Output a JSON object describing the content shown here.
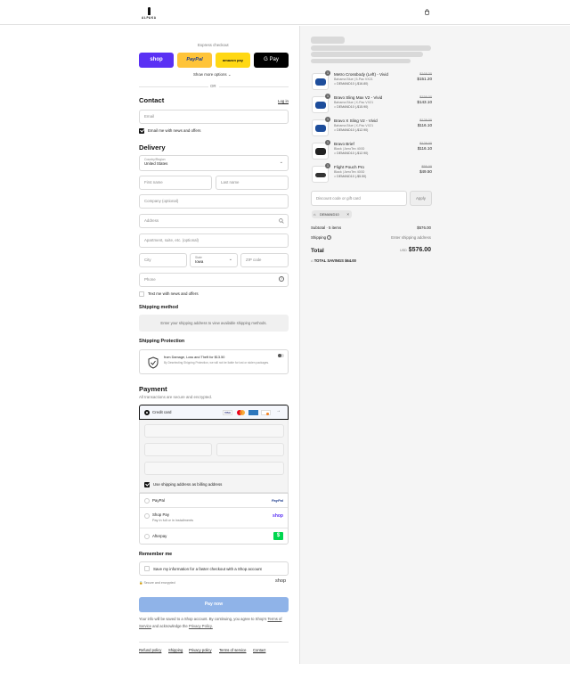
{
  "brand": {
    "name": "ALPAKA"
  },
  "express": {
    "title": "Express checkout",
    "buttons": [
      {
        "label": "shop",
        "color": "#5a31f4"
      },
      {
        "label": "PayPal",
        "color": "#ffc439"
      },
      {
        "label": "amazon pay",
        "color": "#ffd814"
      },
      {
        "label": "G Pay",
        "color": "#000000"
      }
    ],
    "show_more": "Show more options",
    "or": "OR"
  },
  "contact": {
    "heading": "Contact",
    "login": "Log in",
    "email_placeholder": "Email",
    "news_label": "Email me with news and offers"
  },
  "delivery": {
    "heading": "Delivery",
    "country_label": "Country/Region",
    "country_value": "United States",
    "first_name": "First name",
    "last_name": "Last name",
    "company": "Company (optional)",
    "address": "Address",
    "apartment": "Apartment, suite, etc. (optional)",
    "city": "City",
    "state_label": "State",
    "state_value": "Iowa",
    "zip": "ZIP code",
    "phone": "Phone",
    "text_label": "Text me with news and offers"
  },
  "shipping": {
    "heading": "Shipping method",
    "placeholder": "Enter your shipping address to view available shipping methods."
  },
  "protection": {
    "heading": "Shipping Protection",
    "title": "from Damage, Loss and Theft for $13.50",
    "desc": "By Deselecting Shipping Protection, we will not be liable for lost or stolen packages."
  },
  "payment": {
    "heading": "Payment",
    "subtitle": "All transactions are secure and encrypted.",
    "credit_card": "Credit card",
    "billing_label": "Use shipping address as billing address",
    "options": [
      {
        "label": "PayPal",
        "brand": "PayPal"
      },
      {
        "label": "Shop Pay",
        "sub": "Pay in full or in installments",
        "brand": "shop"
      },
      {
        "label": "Afterpay",
        "brand": "$"
      }
    ]
  },
  "remember": {
    "heading": "Remember me",
    "label": "Save my information for a faster checkout with a Shop account",
    "secure": "Secure and encrypted",
    "brand": "shop"
  },
  "pay_now": "Pay now",
  "legal": {
    "text1": "Your info will be saved to a Shop account. By continuing, you agree to Shop's",
    "tos": "Terms of Service",
    "text2": "and acknowledge the",
    "privacy": "Privacy Policy."
  },
  "footer": [
    "Refund policy",
    "Shipping",
    "Privacy policy",
    "Terms of service",
    "Contact"
  ],
  "cart": {
    "items": [
      {
        "qty": "1",
        "name": "Metro Crossbody (Left) - Vivid",
        "variant": "Bahama Blue | 5-Pac VX21",
        "discount": "DEMAND10 (-$16.80)",
        "old": "$168.00",
        "new": "$151.20",
        "color": "#1d4d9b"
      },
      {
        "qty": "1",
        "name": "Bravo Sling Max V2 - Vivid",
        "variant": "Bahama Blue | X-Pac VX21",
        "discount": "DEMAND10 (-$15.90)",
        "old": "$159.00",
        "new": "$143.10",
        "color": "#1d4d9b"
      },
      {
        "qty": "1",
        "name": "Bravo X Sling V2 - Vivid",
        "variant": "Bahama Blue | X-Pac VX21",
        "discount": "DEMAND10 (-$12.90)",
        "old": "$129.00",
        "new": "$116.10",
        "color": "#1d4d9b"
      },
      {
        "qty": "1",
        "name": "Bravo Brief",
        "variant": "Black | AeroTex 400D",
        "discount": "DEMAND10 (-$12.90)",
        "old": "$129.00",
        "new": "$116.10",
        "color": "#222222"
      },
      {
        "qty": "1",
        "name": "Flight Pouch Pro",
        "variant": "Black | AeroTex 400D",
        "discount": "DEMAND10 (-$5.50)",
        "old": "$55.00",
        "new": "$49.50",
        "color": "#333333"
      }
    ],
    "discount_placeholder": "Discount code or gift card",
    "apply": "Apply",
    "chip": "DEMAND10",
    "subtotal_label": "Subtotal · 5 items",
    "subtotal_value": "$576.00",
    "shipping_label": "Shipping",
    "shipping_value": "Enter shipping address",
    "total_label": "Total",
    "currency": "USD",
    "total_value": "$576.00",
    "savings_label": "TOTAL SAVINGS",
    "savings_value": "$64.00"
  }
}
